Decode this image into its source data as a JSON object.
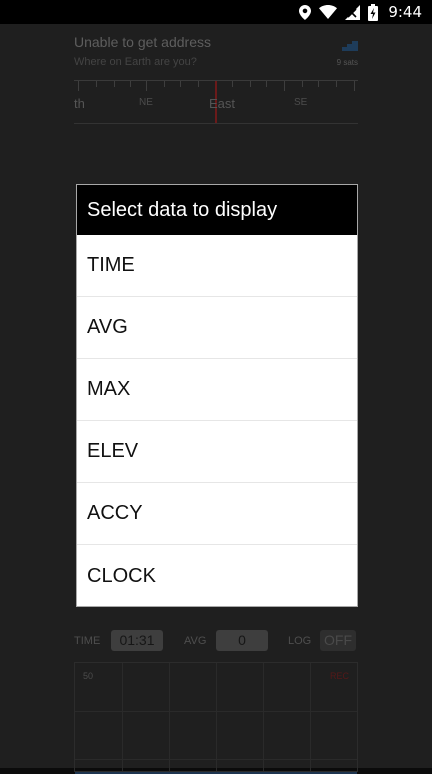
{
  "status_bar": {
    "time": "9:44",
    "icons": [
      "location-icon",
      "wifi-icon",
      "signal-icon",
      "battery-icon"
    ]
  },
  "background": {
    "address_title": "Unable to get address",
    "address_subtitle": "Where on Earth are you?",
    "sats": "9 sats",
    "compass_labels": [
      "th",
      "NE",
      "East",
      "SE"
    ],
    "stats": {
      "time_label": "TIME",
      "time_value": "01:31",
      "avg_label": "AVG",
      "avg_value": "0",
      "log_label": "LOG",
      "log_value": "OFF"
    },
    "graph_max": "50",
    "rec_label": "REC"
  },
  "dialog": {
    "title": "Select data to display",
    "options": [
      "TIME",
      "AVG",
      "MAX",
      "ELEV",
      "ACCY",
      "CLOCK"
    ]
  },
  "colors": {
    "dialog_header": "#000000",
    "dialog_body": "#ffffff",
    "compass_heading": "#6b1a1a",
    "rec": "#561818"
  }
}
